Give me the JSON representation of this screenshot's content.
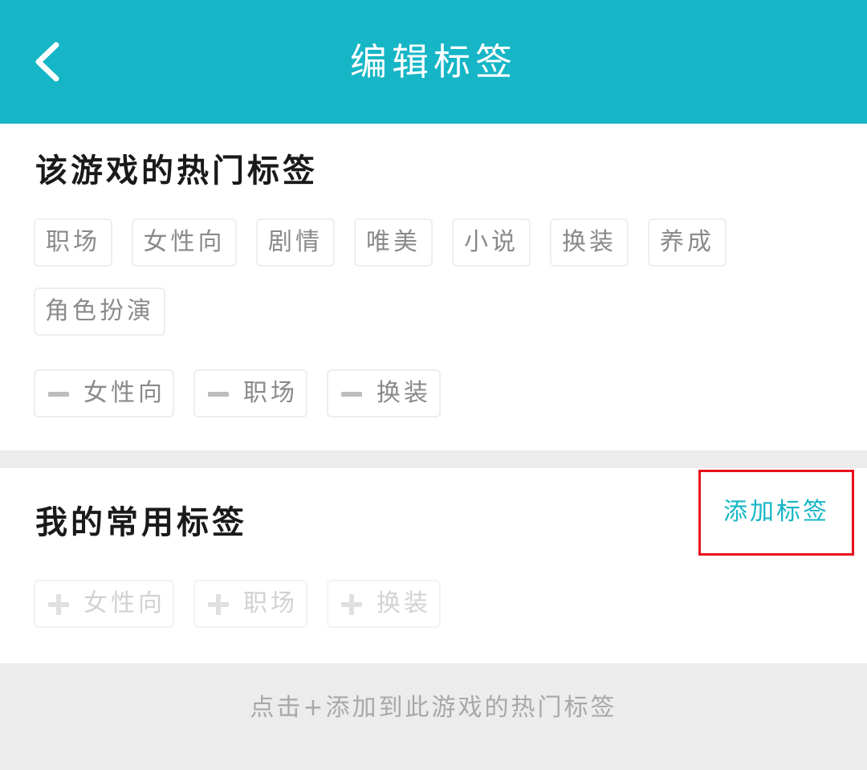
{
  "header": {
    "title": "编辑标签",
    "back_icon": "chevron-left-icon",
    "background_color": "#16b6c6"
  },
  "hot_tags_section": {
    "heading": "该游戏的热门标签",
    "tags": [
      {
        "label": "职场"
      },
      {
        "label": "女性向"
      },
      {
        "label": "剧情"
      },
      {
        "label": "唯美"
      },
      {
        "label": "小说"
      },
      {
        "label": "换装"
      },
      {
        "label": "养成"
      },
      {
        "label": "角色扮演"
      }
    ],
    "selected_tags": [
      {
        "label": "女性向",
        "icon": "minus-icon"
      },
      {
        "label": "职场",
        "icon": "minus-icon"
      },
      {
        "label": "换装",
        "icon": "minus-icon"
      }
    ]
  },
  "common_tags_section": {
    "heading": "我的常用标签",
    "add_tag_label": "添加标签",
    "tags": [
      {
        "label": "女性向",
        "icon": "plus-icon"
      },
      {
        "label": "职场",
        "icon": "plus-icon"
      },
      {
        "label": "换装",
        "icon": "plus-icon"
      }
    ]
  },
  "footer": {
    "hint": "点击+添加到此游戏的热门标签"
  },
  "colors": {
    "accent": "#16b6c6",
    "highlight_border": "#e8101c",
    "divider": "#ececec"
  }
}
